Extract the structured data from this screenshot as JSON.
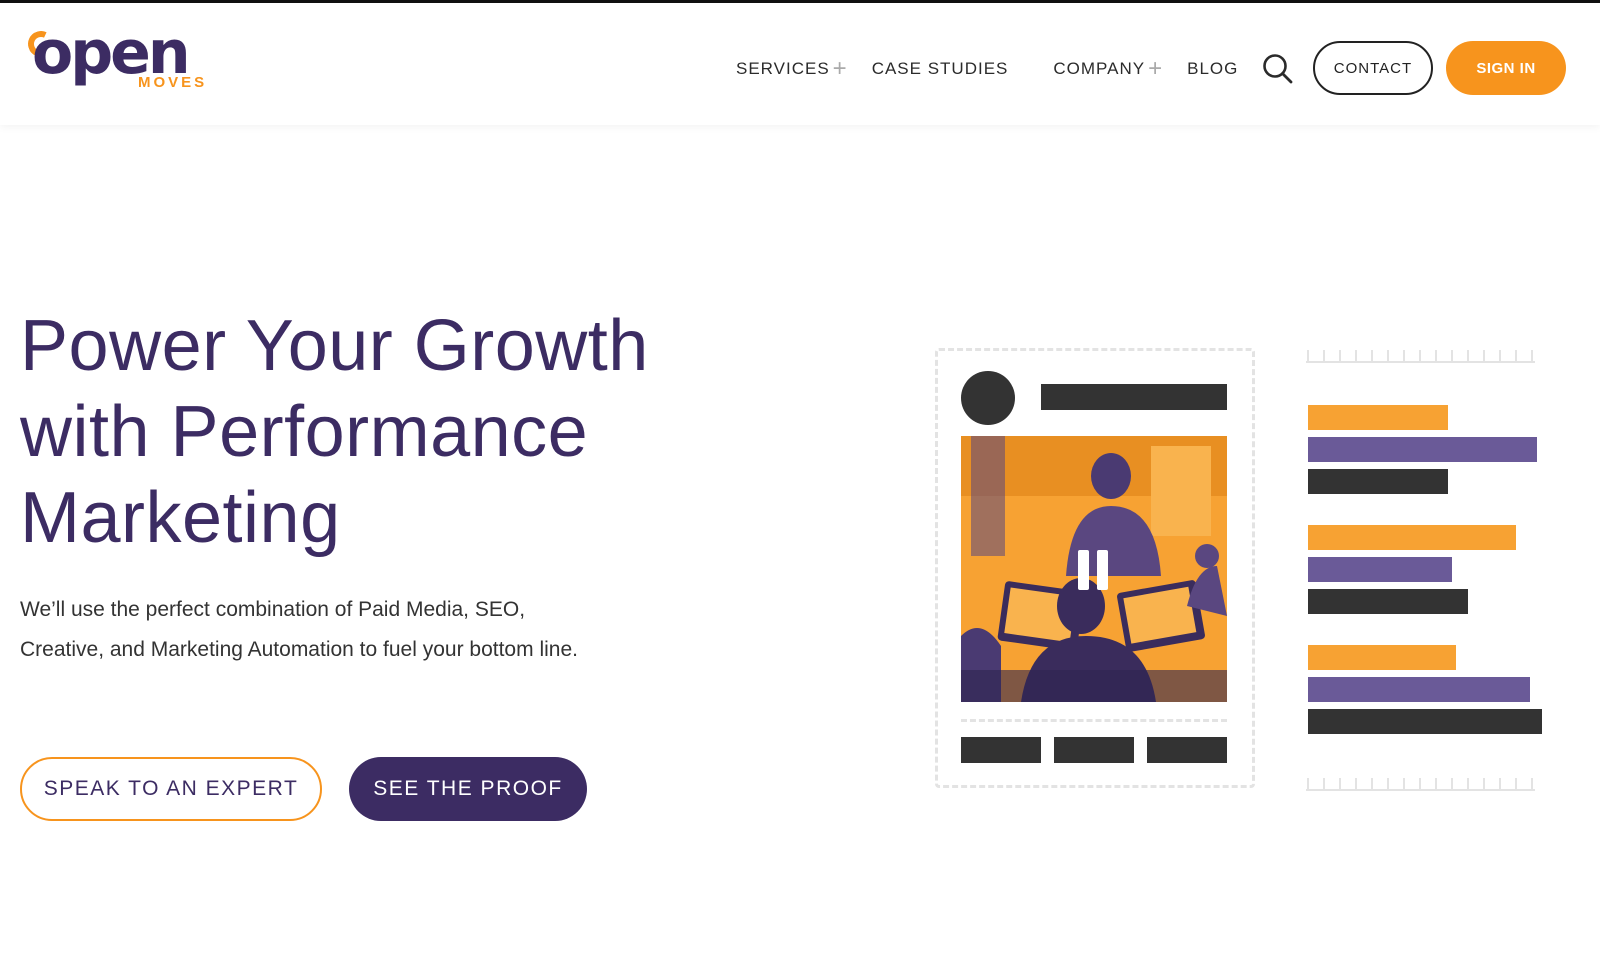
{
  "header": {
    "logo": {
      "word": "open",
      "sub": "MOVES"
    },
    "nav": [
      {
        "label": "SERVICES",
        "has_submenu": true
      },
      {
        "label": "CASE STUDIES",
        "has_submenu": false
      },
      {
        "label": "COMPANY",
        "has_submenu": true
      },
      {
        "label": "BLOG",
        "has_submenu": false
      }
    ],
    "submenu_symbol": "+",
    "search_icon": "search-icon",
    "contact_label": "CONTACT",
    "signin_label": "SIGN IN"
  },
  "hero": {
    "title_lines": [
      "Power Your Growth",
      "with Performance",
      "Marketing"
    ],
    "subtitle_lines": [
      "We’ll use the perfect combination of Paid Media, SEO,",
      "Creative, and Marketing Automation to fuel your bottom line."
    ],
    "cta_primary": "SPEAK TO AN EXPERT",
    "cta_secondary": "SEE THE PROOF"
  },
  "illustration": {
    "media_control_icon": "pause-icon"
  },
  "colors": {
    "brand_purple": "#3c2c63",
    "brand_orange": "#f7941d",
    "bar_purple": "#6a5a98",
    "dark": "#333333"
  }
}
